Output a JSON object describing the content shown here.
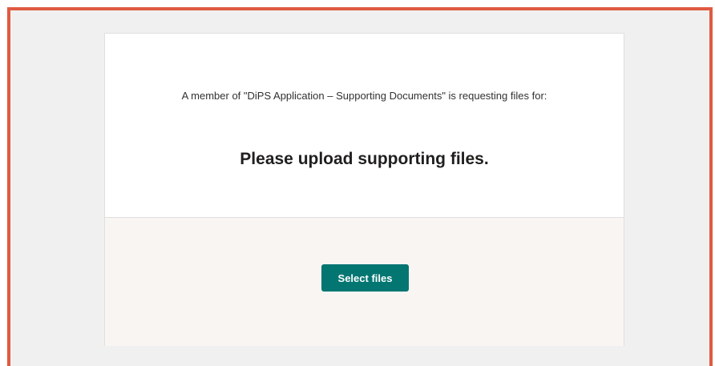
{
  "request": {
    "intro_text": "A member of \"DiPS Application – Supporting Documents\" is requesting files for:",
    "title": "Please upload supporting files."
  },
  "actions": {
    "select_files_label": "Select files"
  },
  "colors": {
    "frame_border": "#e05a41",
    "page_background": "#f0f0f0",
    "card_background": "#ffffff",
    "footer_background": "#f8f5f3",
    "button_background": "#037672",
    "button_text": "#ffffff"
  }
}
